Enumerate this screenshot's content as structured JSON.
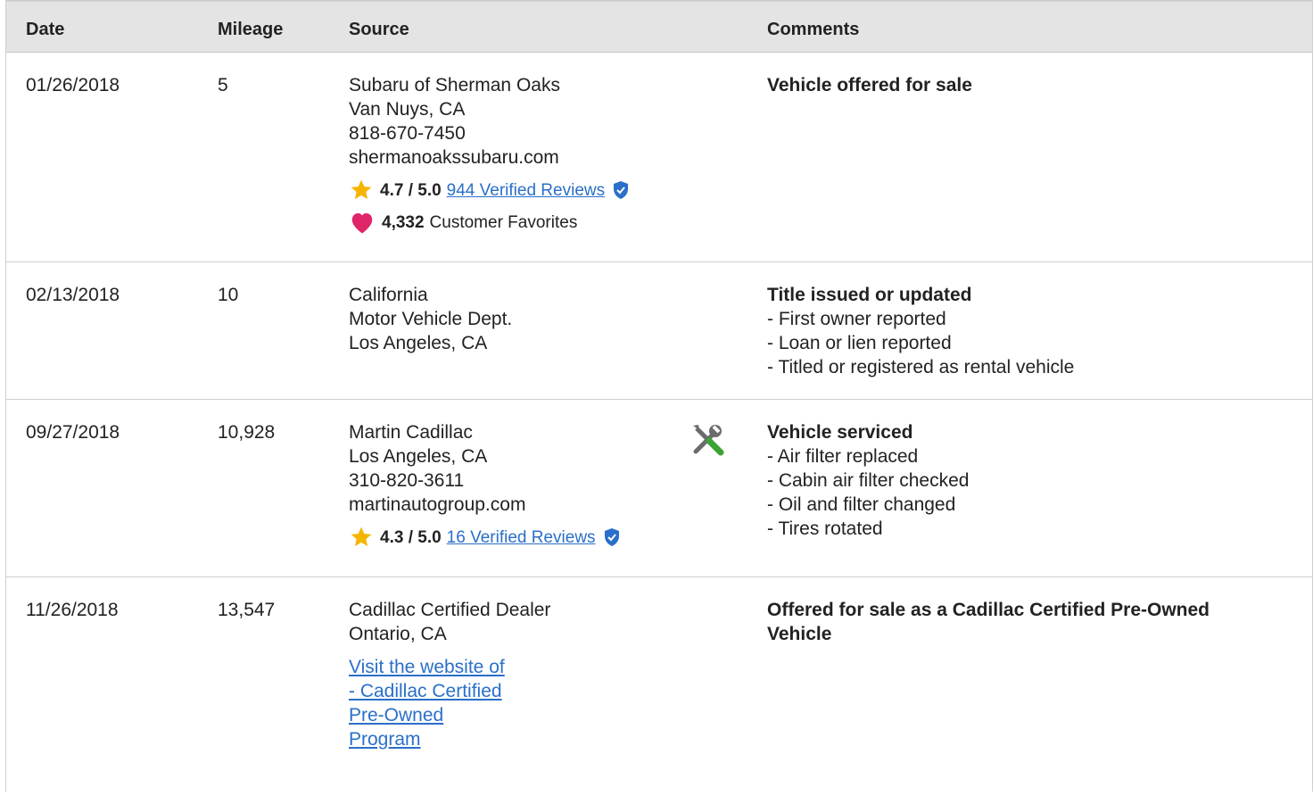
{
  "header": {
    "date": "Date",
    "mileage": "Mileage",
    "source": "Source",
    "comments": "Comments"
  },
  "rows": [
    {
      "date": "01/26/2018",
      "mileage": "5",
      "source": [
        "Subaru of Sherman Oaks",
        "Van Nuys, CA",
        "818-670-7450",
        "shermanoakssubaru.com"
      ],
      "rating": "4.7 / 5.0",
      "reviews": "944 Verified Reviews",
      "favorites_count": "4,332",
      "favorites_label": "Customer Favorites",
      "comment_title": "Vehicle offered for sale",
      "comment_items": []
    },
    {
      "date": "02/13/2018",
      "mileage": "10",
      "source": [
        "California",
        "Motor Vehicle Dept.",
        "Los Angeles, CA"
      ],
      "comment_title": "Title issued or updated",
      "comment_items": [
        "- First owner reported",
        "- Loan or lien reported",
        "- Titled or registered as rental vehicle"
      ]
    },
    {
      "date": "09/27/2018",
      "mileage": "10,928",
      "source": [
        "Martin Cadillac",
        "Los Angeles, CA",
        "310-820-3611",
        "martinautogroup.com"
      ],
      "rating": "4.3 / 5.0",
      "reviews": "16 Verified Reviews",
      "icon": "service-wrench-icon",
      "comment_title": "Vehicle serviced",
      "comment_items": [
        "- Air filter replaced",
        "- Cabin air filter checked",
        "- Oil and filter changed",
        "- Tires rotated"
      ]
    },
    {
      "date": "11/26/2018",
      "mileage": "13,547",
      "source": [
        "Cadillac Certified Dealer",
        "Ontario, CA"
      ],
      "link": "Visit the website of - Cadillac Certified Pre-Owned Program",
      "comment_title": "Offered for sale as a Cadillac Certified Pre-Owned Vehicle"
    }
  ],
  "colors": {
    "link": "#2a6fc9",
    "header_bg": "#e4e4e4",
    "star": "#f5b400",
    "heart": "#e0246a",
    "shield": "#2a6fc9"
  }
}
